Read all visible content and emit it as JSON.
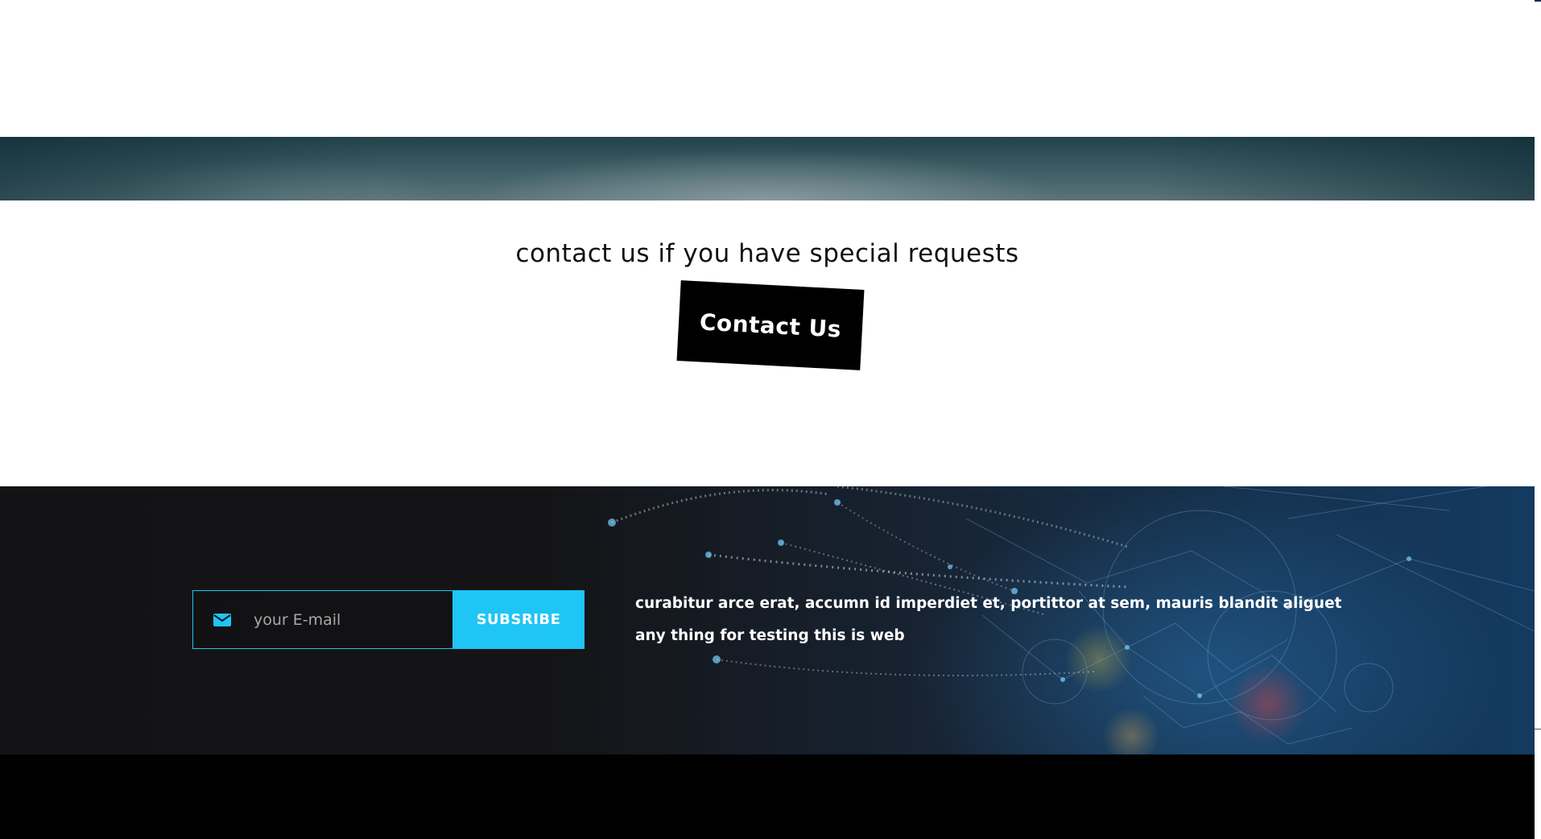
{
  "contact": {
    "heading": "contact us if you have special requests",
    "button_label": "Contact Us"
  },
  "newsletter": {
    "email_placeholder": "your E-mail",
    "subscribe_label": "SUBSRIBE",
    "description": "curabitur arce erat, accumn id imperdiet et, portittor at sem, mauris blandit aliguet any thing for testing this is web",
    "icons": {
      "email": "envelope-icon"
    }
  },
  "colors": {
    "accent": "#1ec5f5",
    "button_dark": "#000000",
    "section_dark": "#131315",
    "footer": "#000000"
  }
}
